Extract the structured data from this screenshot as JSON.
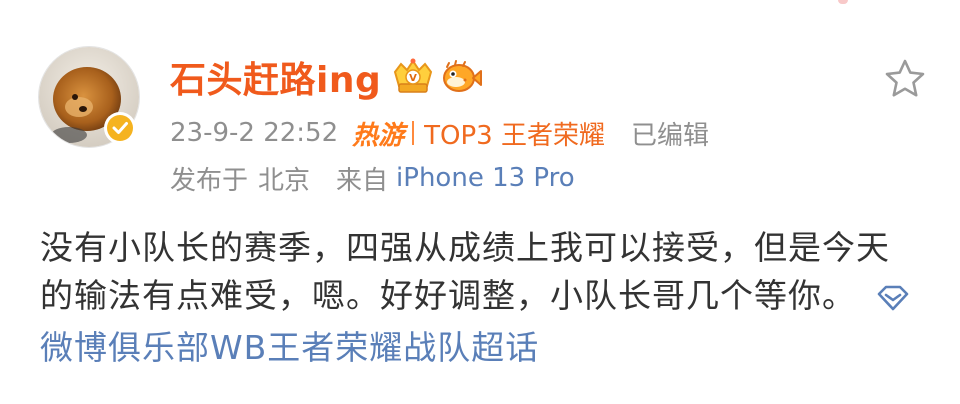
{
  "user": {
    "name": "石头赶路ing",
    "verified": true,
    "badges": [
      "crown-badge-icon",
      "pufferfish-badge-icon"
    ]
  },
  "meta": {
    "timestamp": "23-9-2 22:52",
    "hot_tag": "热游",
    "game_rank": "TOP3 王者荣耀",
    "edited": "已编辑",
    "location_label": "发布于",
    "location": "北京",
    "from_label": "来自",
    "device": "iPhone 13 Pro"
  },
  "post": {
    "text": "没有小队长的赛季，四强从成绩上我可以接受，但是今天的输法有点难受，嗯。好好调整，小队长哥几个等你。",
    "topic": "微博俱乐部WB王者荣耀战队超话"
  },
  "colors": {
    "username": "#f05a1c",
    "link": "#5a7fb8",
    "meta": "#8f8f8f",
    "accent": "#ff7a1a"
  }
}
